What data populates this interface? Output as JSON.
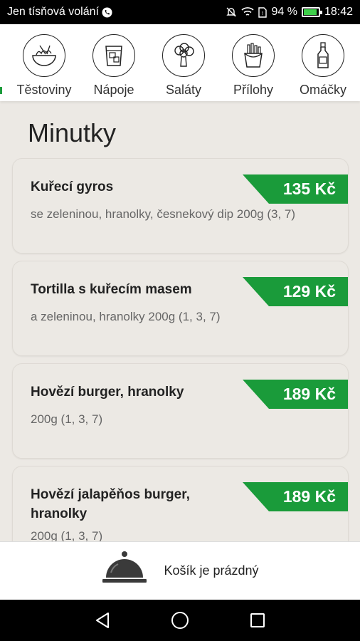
{
  "status_bar": {
    "carrier": "Jen tísňová volání",
    "battery": "94 %",
    "time": "18:42"
  },
  "categories": [
    {
      "label": "Těstoviny",
      "icon": "pasta-bowl-icon"
    },
    {
      "label": "Nápoje",
      "icon": "drink-glass-icon"
    },
    {
      "label": "Saláty",
      "icon": "broccoli-icon"
    },
    {
      "label": "Přílohy",
      "icon": "fries-icon"
    },
    {
      "label": "Omáčky",
      "icon": "sauce-bottle-icon"
    }
  ],
  "section": {
    "title": "Minutky"
  },
  "items": [
    {
      "name": "Kuřecí gyros",
      "description": "se zeleninou, hranolky, česnekový dip 200g (3, 7)",
      "price": "135 Kč"
    },
    {
      "name": "Tortilla s kuřecím masem",
      "description": "a zeleninou, hranolky 200g (1, 3, 7)",
      "price": "129 Kč"
    },
    {
      "name": "Hovězí burger, hranolky",
      "description": "200g (1, 3, 7)",
      "price": "189 Kč"
    },
    {
      "name": "Hovězí jalapěňos burger, hranolky",
      "description": "200g (1, 3, 7)",
      "price": "189 Kč"
    }
  ],
  "cart": {
    "text": "Košík je prázdný",
    "icon": "cloche-icon"
  },
  "colors": {
    "accent": "#1a9b3a",
    "background": "#ece9e4"
  }
}
